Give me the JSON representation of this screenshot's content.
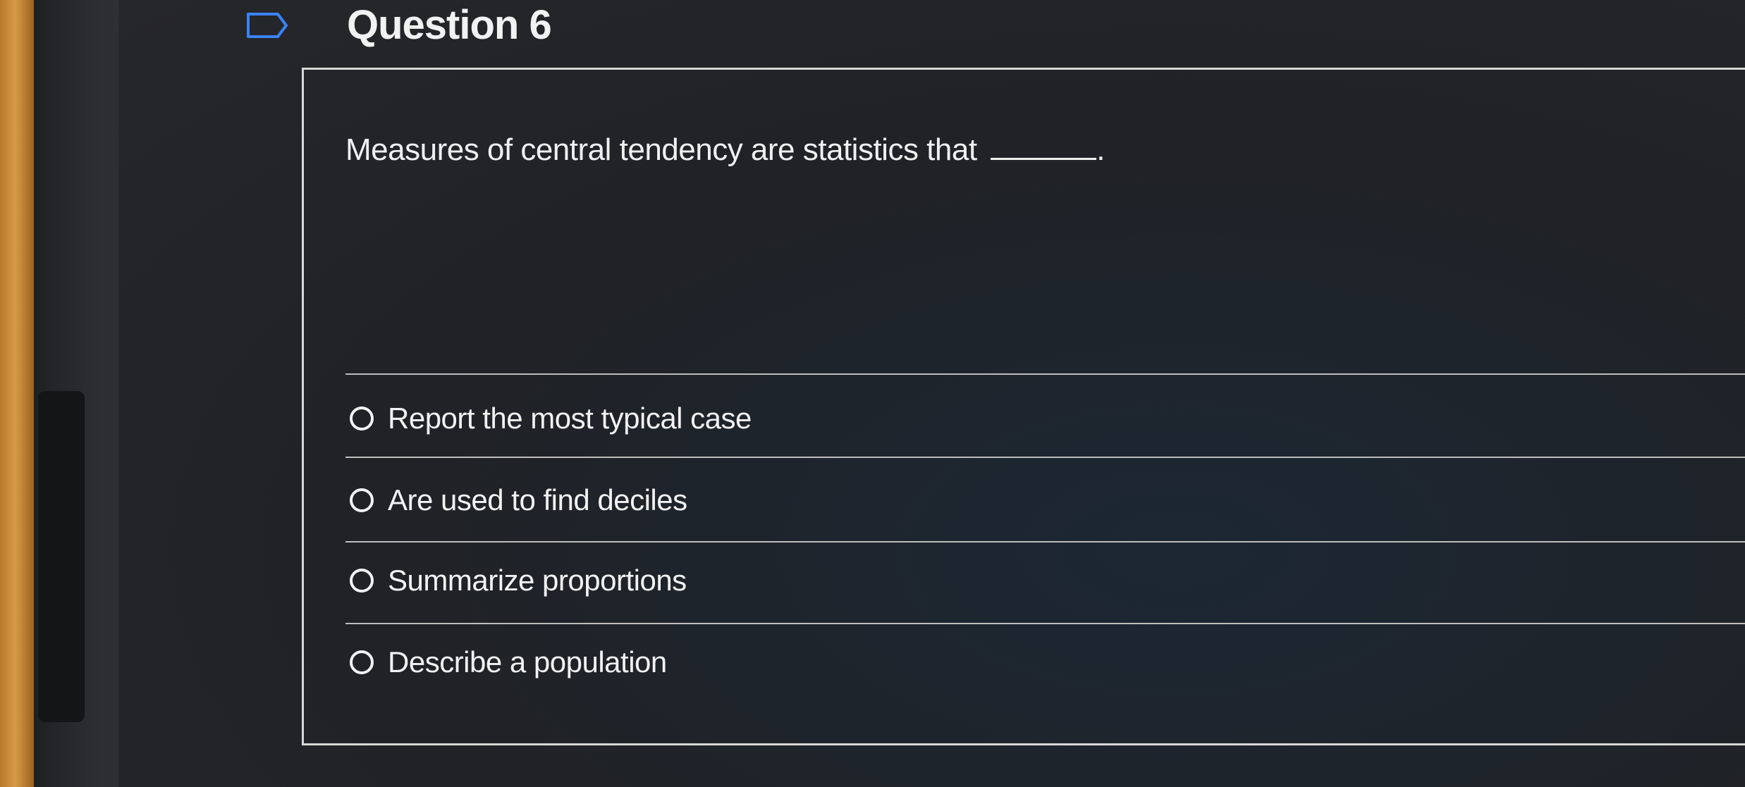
{
  "question": {
    "title": "Question 6",
    "prompt": "Measures of central tendency are statistics that",
    "blank_end": "."
  },
  "answers": [
    {
      "label": "Report the most typical case",
      "selected": false
    },
    {
      "label": "Are used to find deciles",
      "selected": false
    },
    {
      "label": "Summarize proportions",
      "selected": false
    },
    {
      "label": "Describe a population",
      "selected": false
    }
  ],
  "icons": {
    "flag": "flag-icon"
  },
  "colors": {
    "background": "#232427",
    "text": "#f2f2f2",
    "divider": "#bdbdbd"
  }
}
